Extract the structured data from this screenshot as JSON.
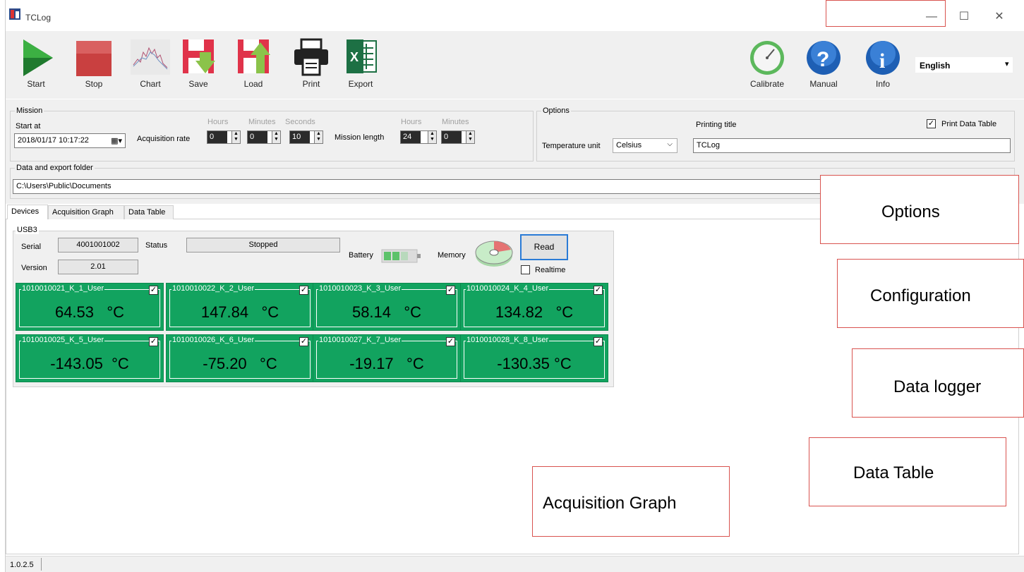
{
  "window": {
    "title": "TCLog",
    "minimize": "—",
    "maximize": "☐",
    "close": "✕"
  },
  "toolbar": {
    "start": "Start",
    "stop": "Stop",
    "chart": "Chart",
    "save": "Save",
    "load": "Load",
    "print": "Print",
    "export": "Export",
    "calibrate": "Calibrate",
    "manual": "Manual",
    "info": "Info",
    "language": "English"
  },
  "mission": {
    "group_title": "Mission",
    "start_at_label": "Start at",
    "start_at_value": "2018/01/17 10:17:22",
    "acq_rate_label": "Acquisition rate",
    "hours_hdr": "Hours",
    "minutes_hdr": "Minutes",
    "seconds_hdr": "Seconds",
    "acq_hours": "0",
    "acq_minutes": "0",
    "acq_seconds": "10",
    "mission_length_label": "Mission length",
    "ml_hours_hdr": "Hours",
    "ml_minutes_hdr": "Minutes",
    "ml_hours": "24",
    "ml_minutes": "0"
  },
  "options": {
    "group_title": "Options",
    "printing_title_label": "Printing title",
    "print_data_table": "Print Data Table",
    "temp_unit_label": "Temperature unit",
    "temp_unit_value": "Celsius",
    "printing_title_value": "TCLog"
  },
  "folder": {
    "group_title": "Data and export folder",
    "path": "C:\\Users\\Public\\Documents",
    "browse": "..."
  },
  "tabs": [
    "Devices",
    "Acquisition Graph",
    "Data Table"
  ],
  "device": {
    "group_title": "USB3",
    "serial_label": "Serial",
    "serial_value": "4001001002",
    "status_label": "Status",
    "status_value": "Stopped",
    "version_label": "Version",
    "version_value": "2.01",
    "battery_label": "Battery",
    "memory_label": "Memory",
    "read_button": "Read",
    "realtime_label": "Realtime"
  },
  "channels": [
    {
      "name": "1010010021_K_1_User",
      "value": "64.53",
      "unit": "°C"
    },
    {
      "name": "1010010022_K_2_User",
      "value": "147.84",
      "unit": "°C"
    },
    {
      "name": "1010010023_K_3_User",
      "value": "58.14",
      "unit": "°C"
    },
    {
      "name": "1010010024_K_4_User",
      "value": "134.82",
      "unit": "°C"
    },
    {
      "name": "1010010025_K_5_User",
      "value": "-143.05",
      "unit": "°C"
    },
    {
      "name": "1010010026_K_6_User",
      "value": "-75.20",
      "unit": "°C"
    },
    {
      "name": "1010010027_K_7_User",
      "value": "-19.17",
      "unit": "°C"
    },
    {
      "name": "1010010028_K_8_User",
      "value": "-130.35",
      "unit": "°C"
    }
  ],
  "statusbar": {
    "version": "1.0.2.5"
  },
  "annotations": {
    "options": "Options",
    "configuration": "Configuration",
    "data_logger": "Data logger",
    "data_table": "Data Table",
    "acquisition_graph": "Acquisition Graph"
  },
  "colors": {
    "channel_green": "#12a35f",
    "annot_border": "#d9534f"
  }
}
